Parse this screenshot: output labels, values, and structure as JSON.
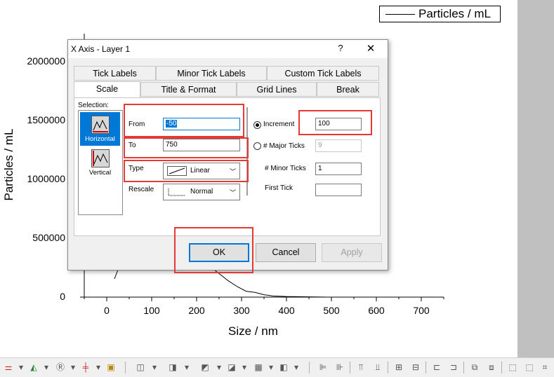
{
  "graph": {
    "legend_label": "Particles / mL",
    "y_axis_title": "Particles / mL",
    "x_axis_title": "Size / nm",
    "y_ticks": [
      "2000000",
      "1500000",
      "1000000",
      "500000",
      "0"
    ],
    "x_ticks": [
      "0",
      "100",
      "200",
      "300",
      "400",
      "500",
      "600",
      "700"
    ]
  },
  "chart_data": {
    "type": "line",
    "xlabel": "Size / nm",
    "ylabel": "Particles / mL",
    "xlim": [
      -50,
      750
    ],
    "ylim": [
      0,
      2000000
    ],
    "legend_position": "top-right",
    "series": [
      {
        "name": "Particles / mL",
        "x": [
          230,
          250,
          270,
          290,
          310,
          330,
          350,
          370,
          400,
          450,
          490
        ],
        "y": [
          260000,
          200000,
          140000,
          90000,
          50000,
          40000,
          20000,
          10000,
          5000,
          2000,
          0
        ]
      }
    ]
  },
  "dialog": {
    "title": "X Axis - Layer 1",
    "help_label": "?",
    "close_label": "✕",
    "tabs_row1": [
      "Tick Labels",
      "Minor Tick Labels",
      "Custom Tick Labels"
    ],
    "tabs_row2": [
      "Scale",
      "Title & Format",
      "Grid Lines",
      "Break"
    ],
    "active_tab": "Scale",
    "selection_label": "Selection:",
    "selection_items": [
      "Horizontal",
      "Vertical"
    ],
    "selected_item": "Horizontal",
    "from_label": "From",
    "from_value": "-50",
    "to_label": "To",
    "to_value": "750",
    "type_label": "Type",
    "type_value": "Linear",
    "rescale_label": "Rescale",
    "rescale_value": "Normal",
    "increment_label": "Increment",
    "increment_value": "100",
    "major_ticks_label": "# Major Ticks",
    "major_ticks_value": "9",
    "minor_ticks_label": "# Minor Ticks",
    "minor_ticks_value": "1",
    "first_tick_label": "First Tick",
    "first_tick_value": "",
    "ok_label": "OK",
    "cancel_label": "Cancel",
    "apply_label": "Apply"
  },
  "colors": {
    "accent": "#0078d7",
    "highlight_box": "#e53935"
  }
}
